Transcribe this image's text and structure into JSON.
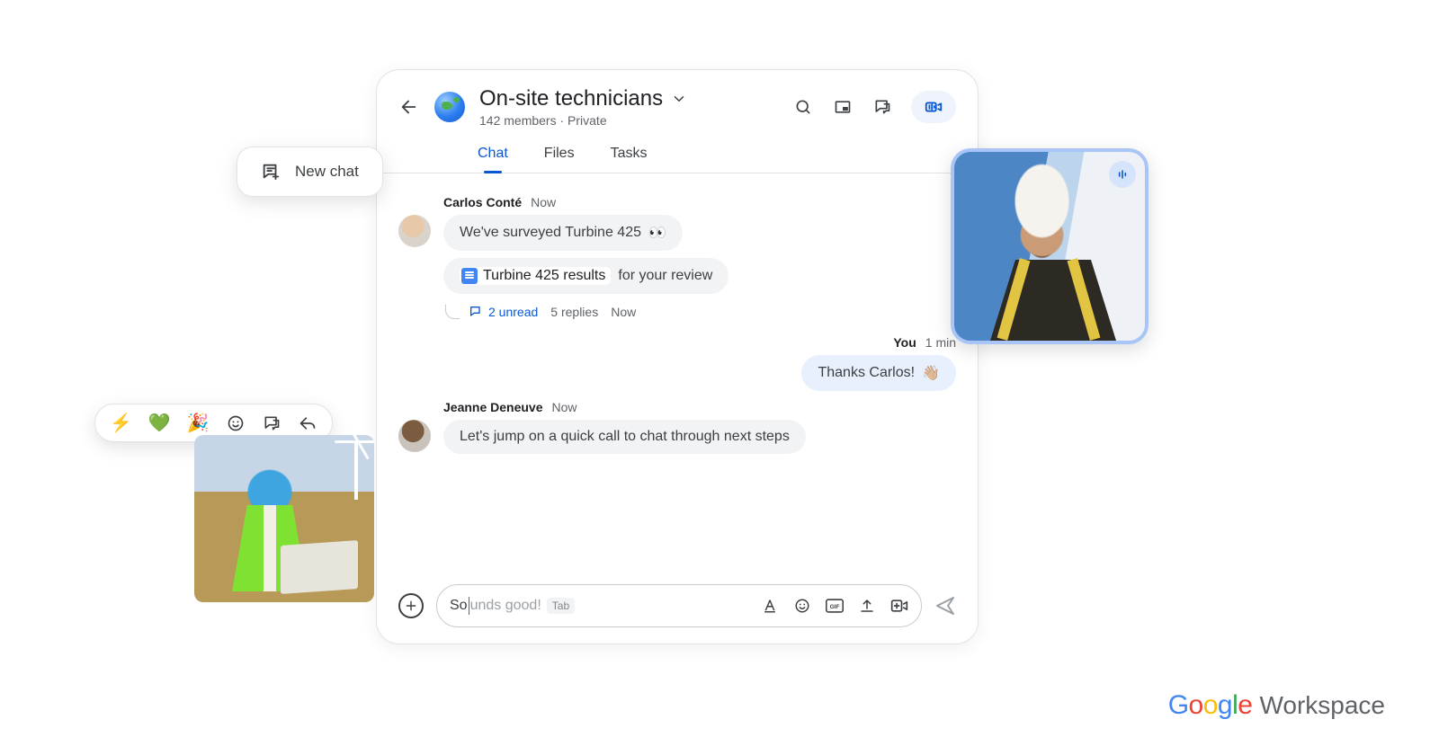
{
  "newChatLabel": "New chat",
  "header": {
    "spaceTitle": "On-site technicians",
    "subtitle": "142 members · Private"
  },
  "tabs": {
    "chat": "Chat",
    "files": "Files",
    "tasks": "Tasks"
  },
  "messages": {
    "carlos": {
      "author": "Carlos Conté",
      "time": "Now",
      "bubble1": "We've surveyed Turbine 425",
      "eyes": "👀",
      "docName": "Turbine 425 results",
      "docTrail": "for your review"
    },
    "thread": {
      "unread": "2 unread",
      "replies": "5 replies",
      "time": "Now"
    },
    "you": {
      "author": "You",
      "time": "1 min",
      "text": "Thanks Carlos!",
      "wave": "👋🏼"
    },
    "jeanne": {
      "author": "Jeanne Deneuve",
      "time": "Now",
      "text": "Let's jump on a quick call to chat through next steps"
    }
  },
  "composer": {
    "typed": "So",
    "suggest": "unds good!",
    "tabHint": "Tab"
  },
  "reactions": {
    "bolt": "⚡",
    "heart": "💚",
    "confetti": "🎉"
  },
  "brand": {
    "google": "Google",
    "workspace": "Workspace"
  }
}
